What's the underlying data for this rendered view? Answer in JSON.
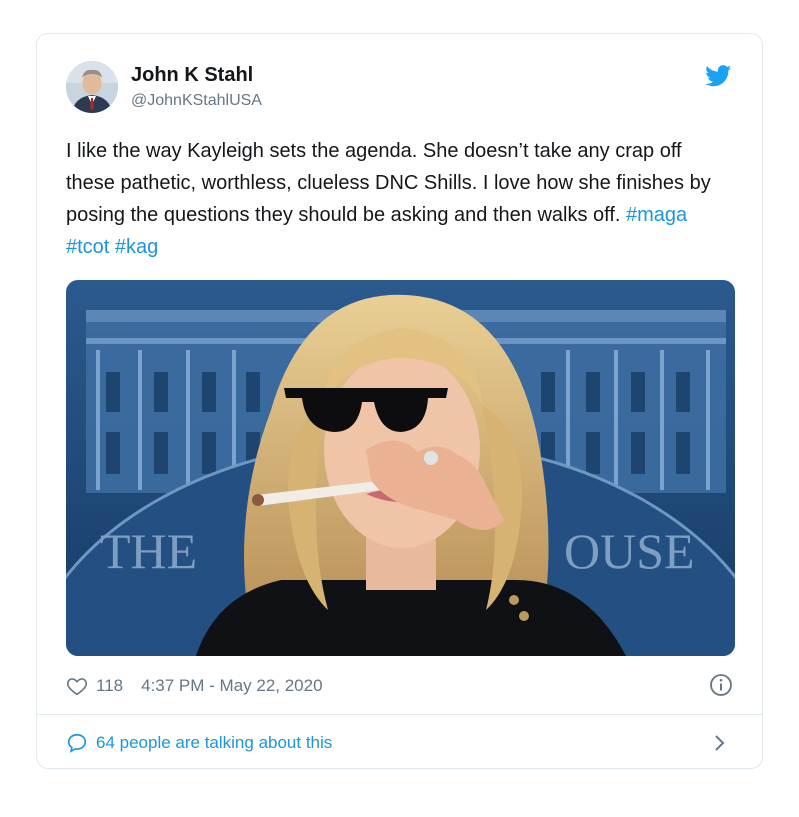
{
  "tweet": {
    "display_name": "John K Stahl",
    "handle": "@JohnKStahlUSA",
    "text_main": "I like the way Kayleigh sets the agenda. She doesn’t take any crap off these pathetic, worthless, clueless DNC Shills. I love how she finishes by posing the questions they should be asking and then walks off.",
    "hashtags": [
      "#maga",
      "#tcot",
      "#kag"
    ],
    "media_building_text_left": "THE",
    "media_building_text_right": "OUSE",
    "likes": "118",
    "timestamp": "4:37 PM - May 22, 2020",
    "talking": "64 people are talking about this"
  },
  "icons": {
    "brand": "twitter-bird-icon",
    "like": "heart-icon",
    "info": "info-icon",
    "reply": "speech-bubble-icon",
    "more": "chevron-right-icon"
  },
  "colors": {
    "brand": "#1da1f2",
    "link": "#1b95e0",
    "secondary_text": "#657786",
    "border": "#e1e8ed"
  }
}
